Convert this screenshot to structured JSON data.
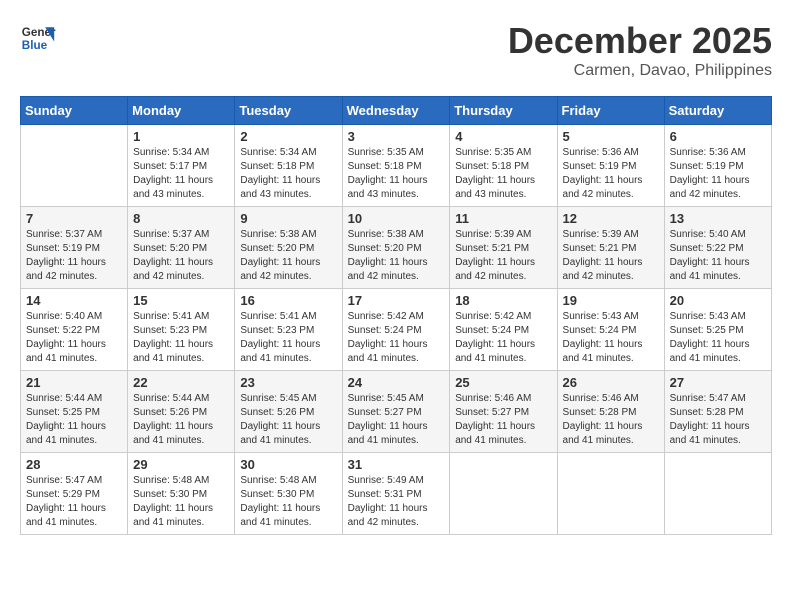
{
  "header": {
    "logo_line1": "General",
    "logo_line2": "Blue",
    "month": "December 2025",
    "location": "Carmen, Davao, Philippines"
  },
  "days_of_week": [
    "Sunday",
    "Monday",
    "Tuesday",
    "Wednesday",
    "Thursday",
    "Friday",
    "Saturday"
  ],
  "weeks": [
    [
      {
        "day": "",
        "sunrise": "",
        "sunset": "",
        "daylight": ""
      },
      {
        "day": "1",
        "sunrise": "Sunrise: 5:34 AM",
        "sunset": "Sunset: 5:17 PM",
        "daylight": "Daylight: 11 hours and 43 minutes."
      },
      {
        "day": "2",
        "sunrise": "Sunrise: 5:34 AM",
        "sunset": "Sunset: 5:18 PM",
        "daylight": "Daylight: 11 hours and 43 minutes."
      },
      {
        "day": "3",
        "sunrise": "Sunrise: 5:35 AM",
        "sunset": "Sunset: 5:18 PM",
        "daylight": "Daylight: 11 hours and 43 minutes."
      },
      {
        "day": "4",
        "sunrise": "Sunrise: 5:35 AM",
        "sunset": "Sunset: 5:18 PM",
        "daylight": "Daylight: 11 hours and 43 minutes."
      },
      {
        "day": "5",
        "sunrise": "Sunrise: 5:36 AM",
        "sunset": "Sunset: 5:19 PM",
        "daylight": "Daylight: 11 hours and 42 minutes."
      },
      {
        "day": "6",
        "sunrise": "Sunrise: 5:36 AM",
        "sunset": "Sunset: 5:19 PM",
        "daylight": "Daylight: 11 hours and 42 minutes."
      }
    ],
    [
      {
        "day": "7",
        "sunrise": "Sunrise: 5:37 AM",
        "sunset": "Sunset: 5:19 PM",
        "daylight": "Daylight: 11 hours and 42 minutes."
      },
      {
        "day": "8",
        "sunrise": "Sunrise: 5:37 AM",
        "sunset": "Sunset: 5:20 PM",
        "daylight": "Daylight: 11 hours and 42 minutes."
      },
      {
        "day": "9",
        "sunrise": "Sunrise: 5:38 AM",
        "sunset": "Sunset: 5:20 PM",
        "daylight": "Daylight: 11 hours and 42 minutes."
      },
      {
        "day": "10",
        "sunrise": "Sunrise: 5:38 AM",
        "sunset": "Sunset: 5:20 PM",
        "daylight": "Daylight: 11 hours and 42 minutes."
      },
      {
        "day": "11",
        "sunrise": "Sunrise: 5:39 AM",
        "sunset": "Sunset: 5:21 PM",
        "daylight": "Daylight: 11 hours and 42 minutes."
      },
      {
        "day": "12",
        "sunrise": "Sunrise: 5:39 AM",
        "sunset": "Sunset: 5:21 PM",
        "daylight": "Daylight: 11 hours and 42 minutes."
      },
      {
        "day": "13",
        "sunrise": "Sunrise: 5:40 AM",
        "sunset": "Sunset: 5:22 PM",
        "daylight": "Daylight: 11 hours and 41 minutes."
      }
    ],
    [
      {
        "day": "14",
        "sunrise": "Sunrise: 5:40 AM",
        "sunset": "Sunset: 5:22 PM",
        "daylight": "Daylight: 11 hours and 41 minutes."
      },
      {
        "day": "15",
        "sunrise": "Sunrise: 5:41 AM",
        "sunset": "Sunset: 5:23 PM",
        "daylight": "Daylight: 11 hours and 41 minutes."
      },
      {
        "day": "16",
        "sunrise": "Sunrise: 5:41 AM",
        "sunset": "Sunset: 5:23 PM",
        "daylight": "Daylight: 11 hours and 41 minutes."
      },
      {
        "day": "17",
        "sunrise": "Sunrise: 5:42 AM",
        "sunset": "Sunset: 5:24 PM",
        "daylight": "Daylight: 11 hours and 41 minutes."
      },
      {
        "day": "18",
        "sunrise": "Sunrise: 5:42 AM",
        "sunset": "Sunset: 5:24 PM",
        "daylight": "Daylight: 11 hours and 41 minutes."
      },
      {
        "day": "19",
        "sunrise": "Sunrise: 5:43 AM",
        "sunset": "Sunset: 5:24 PM",
        "daylight": "Daylight: 11 hours and 41 minutes."
      },
      {
        "day": "20",
        "sunrise": "Sunrise: 5:43 AM",
        "sunset": "Sunset: 5:25 PM",
        "daylight": "Daylight: 11 hours and 41 minutes."
      }
    ],
    [
      {
        "day": "21",
        "sunrise": "Sunrise: 5:44 AM",
        "sunset": "Sunset: 5:25 PM",
        "daylight": "Daylight: 11 hours and 41 minutes."
      },
      {
        "day": "22",
        "sunrise": "Sunrise: 5:44 AM",
        "sunset": "Sunset: 5:26 PM",
        "daylight": "Daylight: 11 hours and 41 minutes."
      },
      {
        "day": "23",
        "sunrise": "Sunrise: 5:45 AM",
        "sunset": "Sunset: 5:26 PM",
        "daylight": "Daylight: 11 hours and 41 minutes."
      },
      {
        "day": "24",
        "sunrise": "Sunrise: 5:45 AM",
        "sunset": "Sunset: 5:27 PM",
        "daylight": "Daylight: 11 hours and 41 minutes."
      },
      {
        "day": "25",
        "sunrise": "Sunrise: 5:46 AM",
        "sunset": "Sunset: 5:27 PM",
        "daylight": "Daylight: 11 hours and 41 minutes."
      },
      {
        "day": "26",
        "sunrise": "Sunrise: 5:46 AM",
        "sunset": "Sunset: 5:28 PM",
        "daylight": "Daylight: 11 hours and 41 minutes."
      },
      {
        "day": "27",
        "sunrise": "Sunrise: 5:47 AM",
        "sunset": "Sunset: 5:28 PM",
        "daylight": "Daylight: 11 hours and 41 minutes."
      }
    ],
    [
      {
        "day": "28",
        "sunrise": "Sunrise: 5:47 AM",
        "sunset": "Sunset: 5:29 PM",
        "daylight": "Daylight: 11 hours and 41 minutes."
      },
      {
        "day": "29",
        "sunrise": "Sunrise: 5:48 AM",
        "sunset": "Sunset: 5:30 PM",
        "daylight": "Daylight: 11 hours and 41 minutes."
      },
      {
        "day": "30",
        "sunrise": "Sunrise: 5:48 AM",
        "sunset": "Sunset: 5:30 PM",
        "daylight": "Daylight: 11 hours and 41 minutes."
      },
      {
        "day": "31",
        "sunrise": "Sunrise: 5:49 AM",
        "sunset": "Sunset: 5:31 PM",
        "daylight": "Daylight: 11 hours and 42 minutes."
      },
      {
        "day": "",
        "sunrise": "",
        "sunset": "",
        "daylight": ""
      },
      {
        "day": "",
        "sunrise": "",
        "sunset": "",
        "daylight": ""
      },
      {
        "day": "",
        "sunrise": "",
        "sunset": "",
        "daylight": ""
      }
    ]
  ]
}
